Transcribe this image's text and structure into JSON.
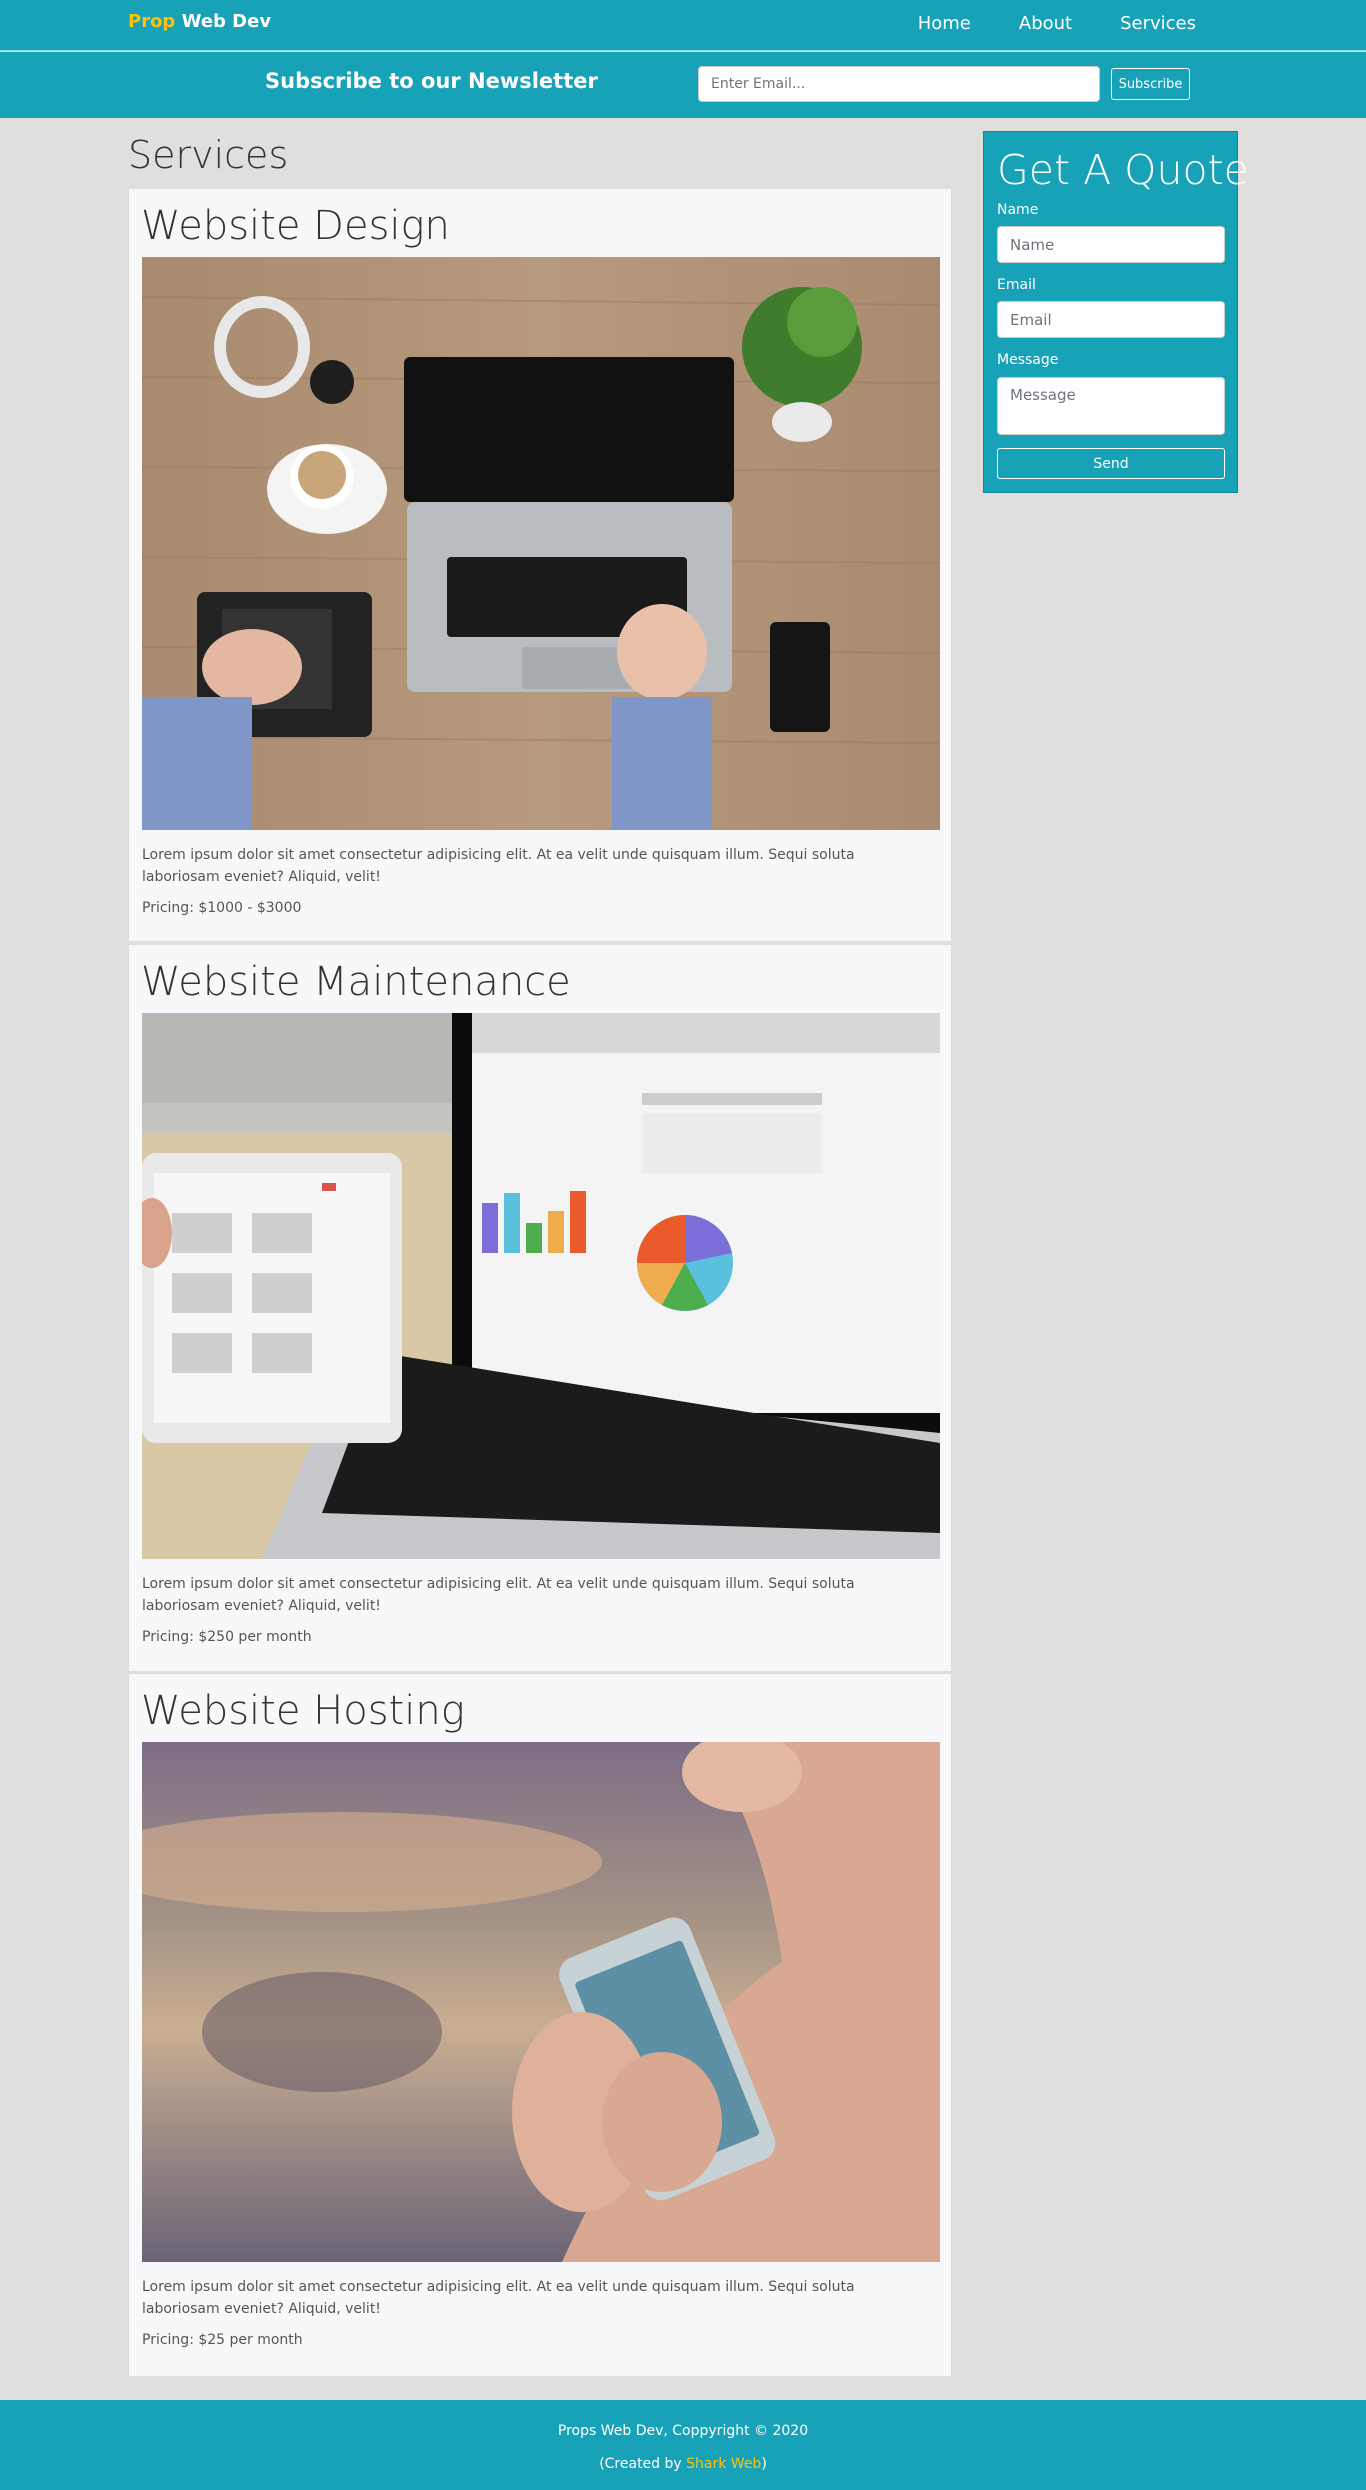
{
  "nav": {
    "brand_highlight": "Prop",
    "brand_rest": "Web Dev",
    "links": [
      "Home",
      "About",
      "Services"
    ]
  },
  "newsletter": {
    "title": "Subscribe to our Newsletter",
    "placeholder": "Enter Email...",
    "button": "Subscribe"
  },
  "main": {
    "title": "Services",
    "cards": [
      {
        "title": "Website Design",
        "image": "laptop-desk-photo",
        "description": "Lorem ipsum dolor sit amet consectetur adipisicing elit. At ea velit unde quisquam illum. Sequi soluta laboriosam eveniet? Aliquid, velit!",
        "pricing": "Pricing: $1000 - $3000"
      },
      {
        "title": "Website Maintenance",
        "image": "laptop-tablet-charts-photo",
        "description": "Lorem ipsum dolor sit amet consectetur adipisicing elit. At ea velit unde quisquam illum. Sequi soluta laboriosam eveniet? Aliquid, velit!",
        "pricing": "Pricing: $250 per month"
      },
      {
        "title": "Website Hosting",
        "image": "hand-holding-phone-photo",
        "description": "Lorem ipsum dolor sit amet consectetur adipisicing elit. At ea velit unde quisquam illum. Sequi soluta laboriosam eveniet? Aliquid, velit!",
        "pricing": "Pricing: $25 per month"
      }
    ]
  },
  "quote": {
    "title": "Get A Quote",
    "name_label": "Name",
    "name_placeholder": "Name",
    "email_label": "Email",
    "email_placeholder": "Email",
    "message_label": "Message",
    "message_placeholder": "Message",
    "button": "Send"
  },
  "footer": {
    "copyright": "Props Web Dev, Coppyright © 2020",
    "created_prefix": "(Created by ",
    "created_link": "Shark Web",
    "created_suffix": ")"
  },
  "colors": {
    "accent": "#17a2b8",
    "brand_highlight": "#ffc107",
    "page_bg": "#e0dfde",
    "card_bg": "#f7f8fa"
  }
}
